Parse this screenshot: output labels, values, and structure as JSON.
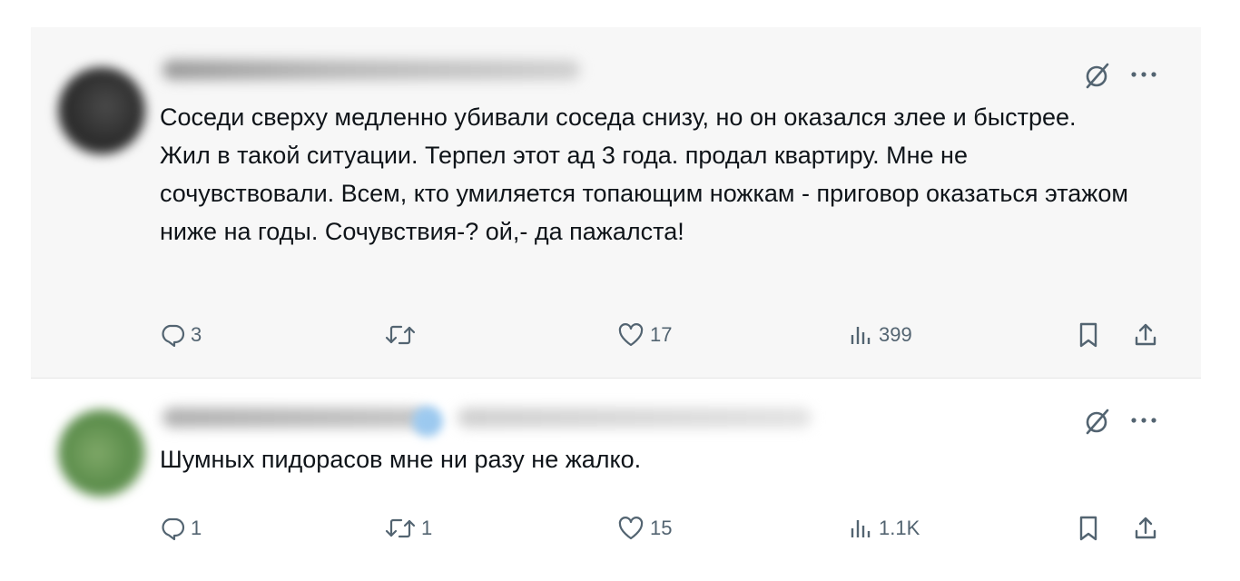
{
  "tweets": [
    {
      "text_lines": [
        "Соседи сверху медленно убивали соседа снизу, но он оказался злее и быстрее.",
        "Жил в такой ситуации. Терпел этот ад 3 года. продал квартиру. Мне не сочувствовали. Всем, кто умиляется топающим ножкам - приговор оказаться этажом ниже на годы. Сочувствия-? ой,- да пажалста!"
      ],
      "replies": "3",
      "retweets": "",
      "likes": "17",
      "views": "399"
    },
    {
      "text_lines": [
        "Шумных пидорасов мне ни разу не жалко."
      ],
      "replies": "1",
      "retweets": "1",
      "likes": "15",
      "views": "1.1K"
    }
  ],
  "icons": {
    "grok": "grok-icon",
    "more": "more-icon",
    "reply": "reply-icon",
    "retweet": "retweet-icon",
    "like": "heart-icon",
    "views": "views-icon",
    "bookmark": "bookmark-icon",
    "share": "share-icon"
  },
  "colors": {
    "text": "#0f1419",
    "secondary": "#536471",
    "highlight_bg": "#f7f7f7"
  }
}
